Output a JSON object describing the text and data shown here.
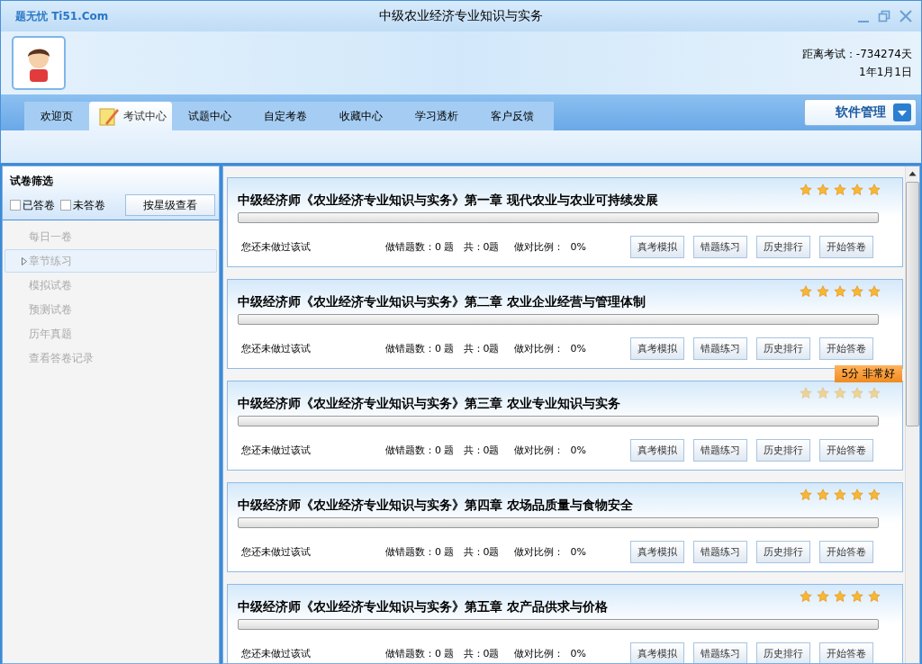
{
  "window": {
    "logo": "题无忧 Ti51.Com",
    "title": "中级农业经济专业知识与实务"
  },
  "countdown": {
    "label": "距离考试：-734274天",
    "date": "1年1月1日"
  },
  "tabs": [
    {
      "label": "欢迎页",
      "selected": false
    },
    {
      "label": "考试中心",
      "selected": true
    },
    {
      "label": "试题中心",
      "selected": false
    },
    {
      "label": "自定考卷",
      "selected": false
    },
    {
      "label": "收藏中心",
      "selected": false
    },
    {
      "label": "学习透析",
      "selected": false
    },
    {
      "label": "客户反馈",
      "selected": false
    }
  ],
  "manage_button": "软件管理",
  "sidebar": {
    "title": "试卷筛选",
    "filters": [
      {
        "label": "已答卷",
        "checked": false
      },
      {
        "label": "未答卷",
        "checked": false
      }
    ],
    "star_button": "按星级查看",
    "items": [
      {
        "label": "每日一卷",
        "selected": false
      },
      {
        "label": "章节练习",
        "selected": true
      },
      {
        "label": "模拟试卷",
        "selected": false
      },
      {
        "label": "预测试卷",
        "selected": false
      },
      {
        "label": "历年真题",
        "selected": false
      },
      {
        "label": "查看答卷记录",
        "selected": false
      }
    ]
  },
  "papers": [
    {
      "title": "中级经济师《农业经济专业知识与实务》第一章  现代农业与农业可持续发展",
      "stars": 5,
      "hovered": false,
      "level": 0,
      "status": "您还未做过该试",
      "wrong": "做错题数：0 题",
      "total": "共：0题",
      "ratio_label": "做对比例：",
      "ratio": "0%",
      "buttons": [
        "真考模拟",
        "错题练习",
        "历史排行",
        "开始答卷"
      ]
    },
    {
      "title": "中级经济师《农业经济专业知识与实务》第二章  农业企业经营与管理体制",
      "stars": 5,
      "hovered": false,
      "level": 0,
      "status": "您还未做过该试",
      "wrong": "做错题数：0 题",
      "total": "共：0题",
      "ratio_label": "做对比例：",
      "ratio": "0%",
      "buttons": [
        "真考模拟",
        "错题练习",
        "历史排行",
        "开始答卷"
      ]
    },
    {
      "title": "中级经济师《农业经济专业知识与实务》第三章  农业专业知识与实务",
      "stars": 5,
      "hovered": true,
      "tooltip": "5分  非常好",
      "level": 0,
      "status": "您还未做过该试",
      "wrong": "做错题数：0 题",
      "total": "共：0题",
      "ratio_label": "做对比例：",
      "ratio": "0%",
      "buttons": [
        "真考模拟",
        "错题练习",
        "历史排行",
        "开始答卷"
      ]
    },
    {
      "title": "中级经济师《农业经济专业知识与实务》第四章  农场品质量与食物安全",
      "stars": 5,
      "hovered": false,
      "level": 0,
      "status": "您还未做过该试",
      "wrong": "做错题数：0 题",
      "total": "共：0题",
      "ratio_label": "做对比例：",
      "ratio": "0%",
      "buttons": [
        "真考模拟",
        "错题练习",
        "历史排行",
        "开始答卷"
      ]
    },
    {
      "title": "中级经济师《农业经济专业知识与实务》第五章  农产品供求与价格",
      "stars": 5,
      "hovered": false,
      "level": 0,
      "status": "您还未做过该试",
      "wrong": "做错题数：0 题",
      "total": "共：0题",
      "ratio_label": "做对比例：",
      "ratio": "0%",
      "buttons": [
        "真考模拟",
        "错题练习",
        "历史排行",
        "开始答卷"
      ]
    }
  ]
}
